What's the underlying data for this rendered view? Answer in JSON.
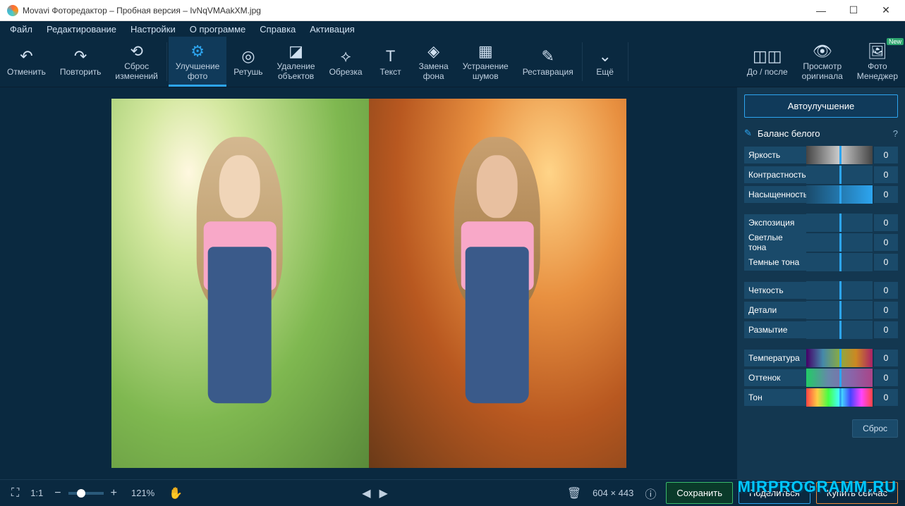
{
  "title": "Movavi Фоторедактор – Пробная версия – IvNqVMAakXM.jpg",
  "menu": [
    "Файл",
    "Редактирование",
    "Настройки",
    "О программе",
    "Справка",
    "Активация"
  ],
  "tools": {
    "undo": "Отменить",
    "redo": "Повторить",
    "reset": "Сброс\nизменений",
    "enhance": "Улучшение\nфото",
    "retouch": "Ретушь",
    "remove": "Удаление\nобъектов",
    "crop": "Обрезка",
    "text": "Текст",
    "bg": "Замена\nфона",
    "noise": "Устранение\nшумов",
    "restore": "Реставрация",
    "more": "Ещё",
    "before": "До / после",
    "orig": "Просмотр\nоригинала",
    "manager": "Фото\nМенеджер",
    "new_badge": "New"
  },
  "side": {
    "auto": "Автоулучшение",
    "wb": "Баланс белого",
    "reset": "Сброс",
    "sliders": {
      "brightness": "Яркость",
      "contrast": "Контрастность",
      "saturation": "Насыщенность",
      "exposure": "Экспозиция",
      "highlights": "Светлые тона",
      "shadows": "Темные тона",
      "sharp": "Четкость",
      "details": "Детали",
      "blur": "Размытие",
      "temp": "Температура",
      "tint": "Оттенок",
      "hue": "Тон"
    },
    "val": "0"
  },
  "status": {
    "ratio": "1:1",
    "zoom": "121%",
    "dims": "604 × 443",
    "save": "Сохранить",
    "share": "Поделиться",
    "buy": "Купить сейчас"
  },
  "watermark": "MIRPROGRAMM.RU"
}
